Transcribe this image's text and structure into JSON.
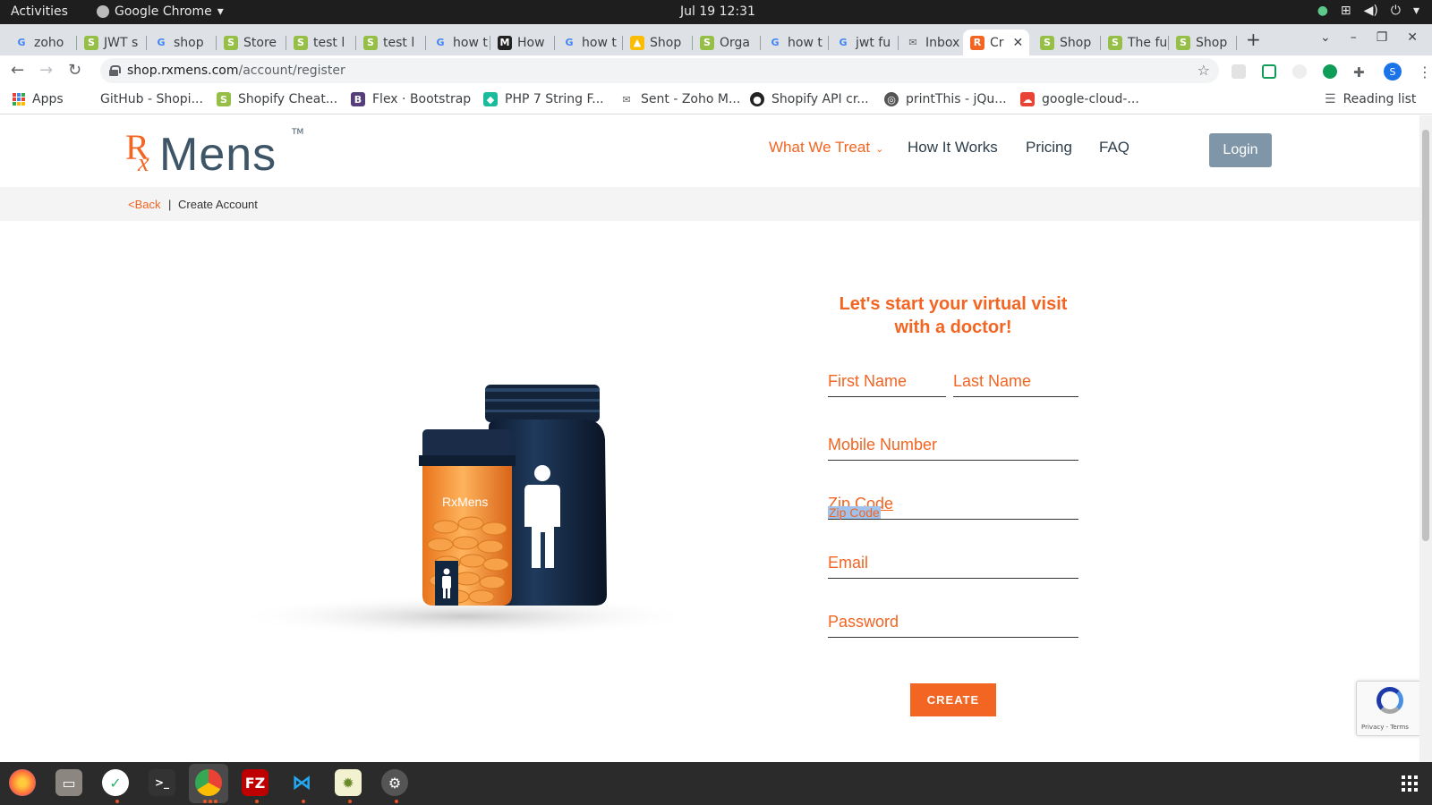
{
  "system": {
    "activities": "Activities",
    "app_name": "Google Chrome",
    "clock": "Jul 19  12:31"
  },
  "tabs": [
    {
      "label": "zoho",
      "icon": "google-icon",
      "color": "#4285f4"
    },
    {
      "label": "JWT s",
      "icon": "shopify-icon",
      "color": "#95bf47"
    },
    {
      "label": "shop",
      "icon": "google-icon",
      "color": "#4285f4"
    },
    {
      "label": "Store",
      "icon": "shopify-icon",
      "color": "#95bf47"
    },
    {
      "label": "test l",
      "icon": "shopify-icon",
      "color": "#95bf47"
    },
    {
      "label": "test l",
      "icon": "shopify-icon",
      "color": "#95bf47"
    },
    {
      "label": "how t",
      "icon": "google-icon",
      "color": "#4285f4"
    },
    {
      "label": "How",
      "icon": "medium-icon",
      "color": "#222222"
    },
    {
      "label": "how t",
      "icon": "google-icon",
      "color": "#4285f4"
    },
    {
      "label": "Shop",
      "icon": "drive-icon",
      "color": "#fbbc05"
    },
    {
      "label": "Orga",
      "icon": "shopify-icon",
      "color": "#95bf47"
    },
    {
      "label": "how t",
      "icon": "google-icon",
      "color": "#4285f4"
    },
    {
      "label": "jwt fu",
      "icon": "google-icon",
      "color": "#4285f4"
    },
    {
      "label": "Inbox",
      "icon": "zoho-mail-icon",
      "color": "#5f6368"
    },
    {
      "label": "Cr",
      "icon": "rxmens-icon",
      "color": "#f26522"
    },
    {
      "label": "Shop",
      "icon": "shopify-icon",
      "color": "#95bf47"
    },
    {
      "label": "The fu",
      "icon": "shopify-icon",
      "color": "#95bf47"
    },
    {
      "label": "Shop",
      "icon": "shopify-icon",
      "color": "#95bf47"
    }
  ],
  "browser": {
    "url_host": "shop.rxmens.com",
    "url_path": "/account/register",
    "profile_initial": "S"
  },
  "bookmarks": [
    {
      "label": "Apps"
    },
    {
      "label": "GitHub - Shopi...",
      "icon": "shopify-icon",
      "color": "#95bf47"
    },
    {
      "label": "Shopify Cheat...",
      "icon": "shopify-icon",
      "color": "#95bf47"
    },
    {
      "label": "Flex · Bootstrap",
      "icon": "bootstrap-icon",
      "color": "#563d7c"
    },
    {
      "label": "PHP 7 String F...",
      "icon": "php-icon",
      "color": "#1abc9c"
    },
    {
      "label": "Sent - Zoho M...",
      "icon": "zoho-mail-icon",
      "color": "#5f6368"
    },
    {
      "label": "Shopify API cr...",
      "icon": "github-icon",
      "color": "#222222"
    },
    {
      "label": "printThis - jQu...",
      "icon": "globe-icon",
      "color": "#555555"
    },
    {
      "label": "google-cloud-...",
      "icon": "gcloud-icon",
      "color": "#ea4335"
    },
    {
      "label": "Reading list",
      "icon": "reading-list-icon"
    }
  ],
  "site": {
    "logo_rx": "R",
    "logo_sub": "x",
    "logo_word": "Mens",
    "logo_tm": "TM",
    "nav": {
      "what_we_treat": "What We Treat",
      "how_it_works": "How It Works",
      "pricing": "Pricing",
      "faq": "FAQ",
      "login": "Login"
    },
    "crumb": {
      "back": "<Back",
      "separator": "|",
      "current": "Create Account"
    },
    "bottle_brand": "RxMens"
  },
  "form": {
    "title_line1": "Let's start your virtual visit",
    "title_line2": "with a doctor!",
    "first_name": "First Name",
    "last_name": "Last Name",
    "mobile": "Mobile Number",
    "zip": "Zip Code",
    "zip_drag_ghost": "Zip Code",
    "email": "Email",
    "password": "Password",
    "submit": "CREATE",
    "recaptcha_text": "Privacy - Terms"
  },
  "colors": {
    "brand_orange": "#f26522",
    "brand_slate": "#3d5566",
    "login_button": "#7f95a8"
  },
  "taskbar": [
    "firefox-icon",
    "files-icon",
    "timetracker-icon",
    "terminal-icon",
    "chrome-icon",
    "filezilla-icon",
    "vscode-icon",
    "app-icon",
    "settings-icon"
  ]
}
